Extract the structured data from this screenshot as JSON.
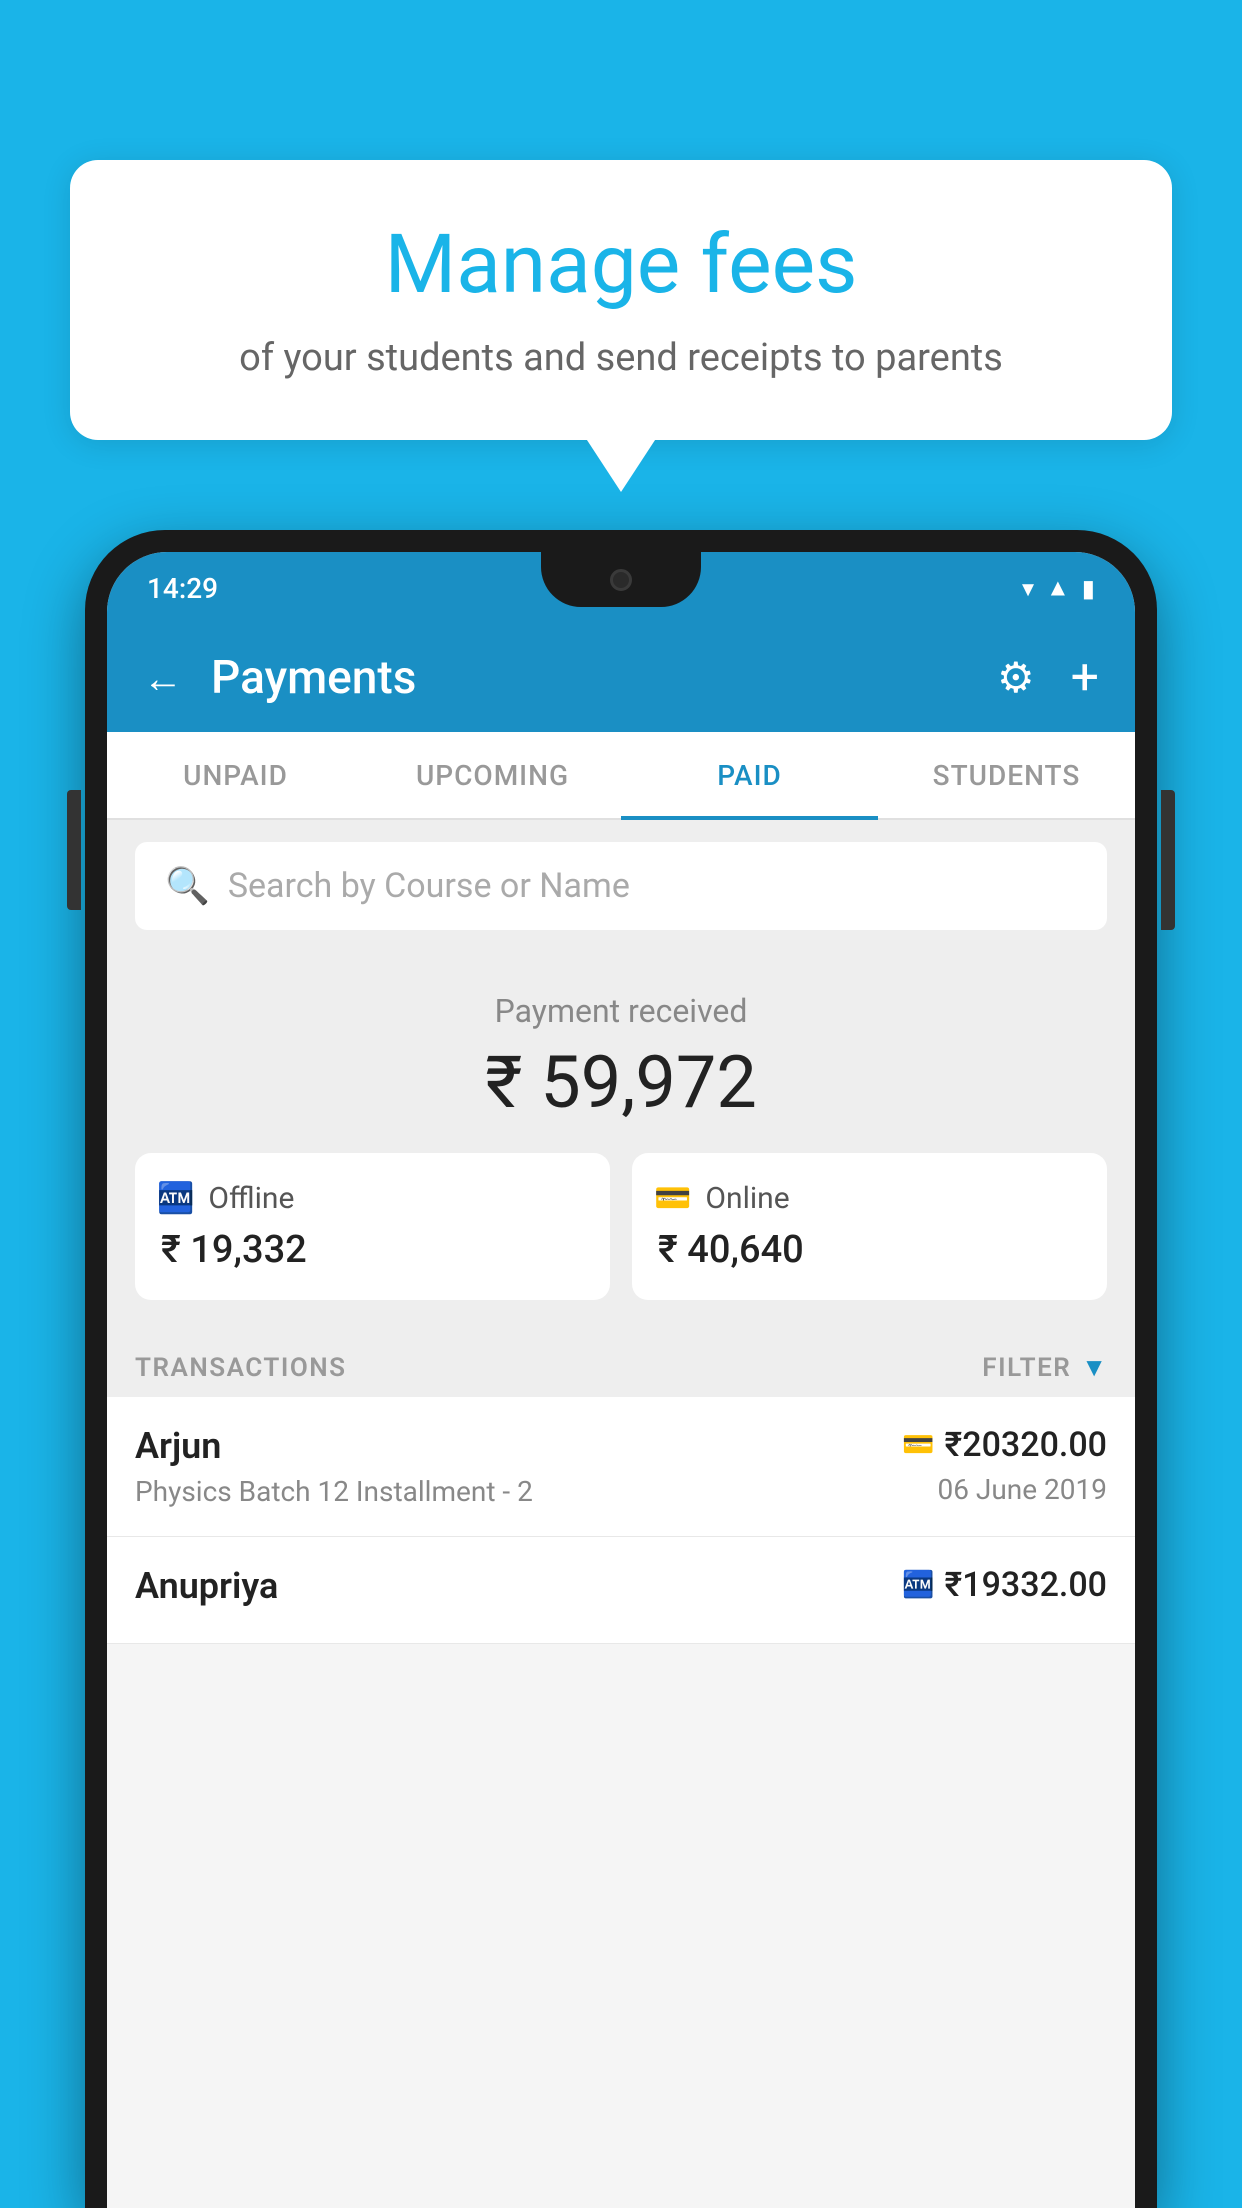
{
  "hero": {
    "title": "Manage fees",
    "subtitle": "of your students and send receipts to parents"
  },
  "status_bar": {
    "time": "14:29",
    "wifi_icon": "▼",
    "signal_icon": "▲",
    "battery_icon": "▮"
  },
  "toolbar": {
    "back_icon": "←",
    "title": "Payments",
    "gear_icon": "⚙",
    "plus_icon": "+"
  },
  "tabs": [
    {
      "label": "UNPAID",
      "active": false
    },
    {
      "label": "UPCOMING",
      "active": false
    },
    {
      "label": "PAID",
      "active": true
    },
    {
      "label": "STUDENTS",
      "active": false
    }
  ],
  "search": {
    "placeholder": "Search by Course or Name"
  },
  "payment_summary": {
    "label": "Payment received",
    "total": "₹ 59,972",
    "offline_label": "Offline",
    "offline_amount": "₹ 19,332",
    "online_label": "Online",
    "online_amount": "₹ 40,640"
  },
  "transactions": {
    "header_label": "TRANSACTIONS",
    "filter_label": "FILTER",
    "items": [
      {
        "name": "Arjun",
        "detail": "Physics Batch 12 Installment - 2",
        "payment_type": "online",
        "amount": "₹20320.00",
        "date": "06 June 2019"
      },
      {
        "name": "Anupriya",
        "detail": "",
        "payment_type": "offline",
        "amount": "₹19332.00",
        "date": ""
      }
    ]
  },
  "colors": {
    "primary_blue": "#1a8fc4",
    "sky_blue": "#1ab4e8",
    "white": "#ffffff",
    "light_gray": "#eeeeee",
    "text_dark": "#222222",
    "text_gray": "#888888"
  }
}
